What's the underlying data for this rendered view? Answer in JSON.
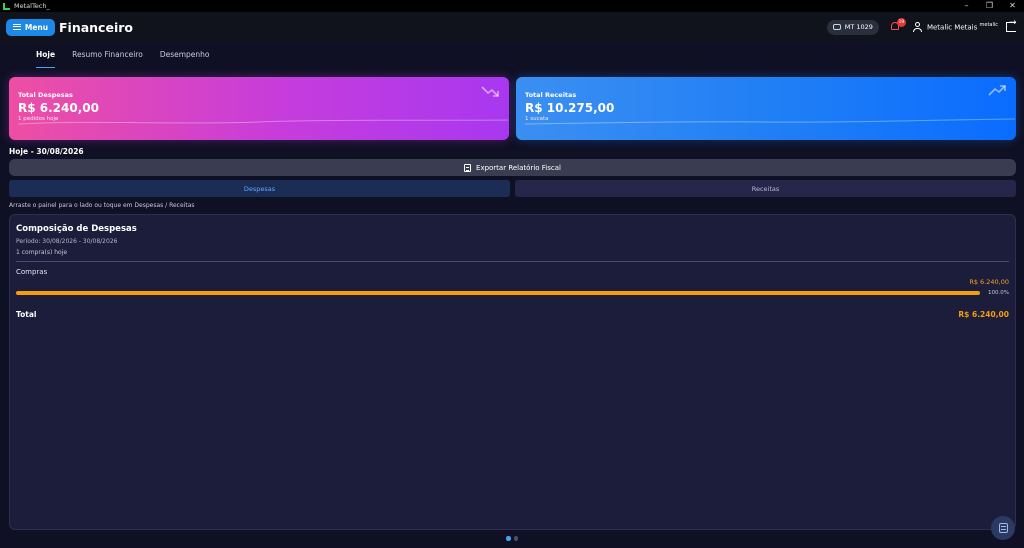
{
  "window": {
    "title": "MetalTech_",
    "controls": [
      "–",
      "❐",
      "✕"
    ]
  },
  "header": {
    "menu_label": "Menu",
    "page_title": "Financeiro",
    "machine_chip": "MT 1029",
    "notification_count": "19",
    "user_name": "Metalic Metais",
    "user_tag": "metalic"
  },
  "tabs": [
    {
      "label": "Hoje",
      "active": true
    },
    {
      "label": "Resumo Financeiro",
      "active": false
    },
    {
      "label": "Desempenho",
      "active": false
    }
  ],
  "cards": {
    "despesas": {
      "label": "Total Despesas",
      "value": "R$ 6.240,00",
      "sub": "1 pedidos hoje"
    },
    "receitas": {
      "label": "Total Receitas",
      "value": "R$ 10.275,00",
      "sub": "1 sucata"
    }
  },
  "date_label": "Hoje - 30/08/2026",
  "export_label": "Exportar Relatório Fiscal",
  "segments": {
    "despesas": "Despesas",
    "receitas": "Receitas"
  },
  "hint": "Arraste o painel para o lado ou toque em Despesas / Receitas",
  "panel": {
    "title": "Composição de Despesas",
    "period": "Período: 30/08/2026 - 30/08/2026",
    "count": "1 compra(s) hoje",
    "category": {
      "name": "Compras",
      "value": "R$ 6.240,00",
      "percent_label": "100.0%",
      "fraction": 1.0
    },
    "total_label": "Total",
    "total_value": "R$ 6.240,00"
  },
  "pager": {
    "pages": 2,
    "current": 1
  },
  "colors": {
    "accent": "#1e88e5",
    "expense_bar": "#f59e0b",
    "badge": "#e53935"
  },
  "icons": [
    "app-icon",
    "hamburger-icon",
    "robot-icon",
    "bell-icon",
    "user-icon",
    "logout-icon",
    "trend-down-icon",
    "trend-up-icon",
    "document-icon",
    "note-icon"
  ]
}
